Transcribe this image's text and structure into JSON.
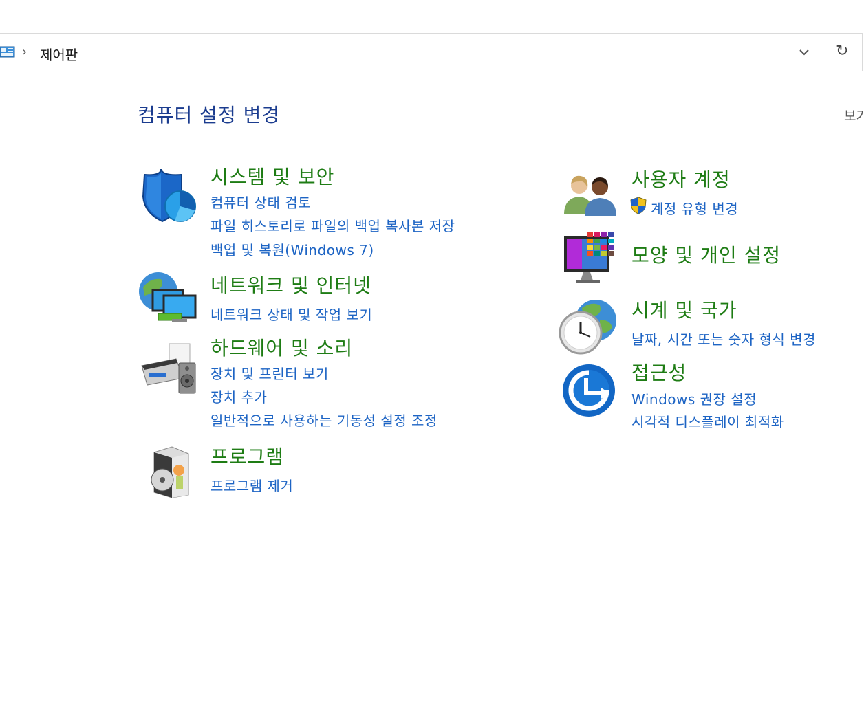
{
  "breadcrumb": {
    "current": "제어판"
  },
  "page": {
    "title": "컴퓨터 설정 변경",
    "view_by": "보기"
  },
  "categories": {
    "security": {
      "title": "시스템 및 보안",
      "links": [
        "컴퓨터 상태 검토",
        "파일 히스토리로 파일의 백업 복사본 저장",
        "백업 및 복원(Windows 7)"
      ]
    },
    "network": {
      "title": "네트워크 및 인터넷",
      "links": [
        "네트워크 상태 및 작업 보기"
      ]
    },
    "hardware": {
      "title": "하드웨어 및 소리",
      "links": [
        "장치 및 프린터 보기",
        "장치 추가",
        "일반적으로 사용하는 기동성 설정 조정"
      ]
    },
    "programs": {
      "title": "프로그램",
      "links": [
        "프로그램 제거"
      ]
    },
    "user_accounts": {
      "title": "사용자 계정",
      "links": [
        "계정 유형 변경"
      ]
    },
    "appearance": {
      "title": "모양 및 개인 설정",
      "links": []
    },
    "clock_region": {
      "title": "시계 및 국가",
      "links": [
        "날짜, 시간 또는 숫자 형식 변경"
      ]
    },
    "accessibility": {
      "title": "접근성",
      "links": [
        "Windows 권장 설정",
        "시각적 디스플레이 최적화"
      ]
    }
  },
  "colors": {
    "title": "#1b3c8f",
    "category": "#1e7c14",
    "link": "#1d64c4"
  }
}
